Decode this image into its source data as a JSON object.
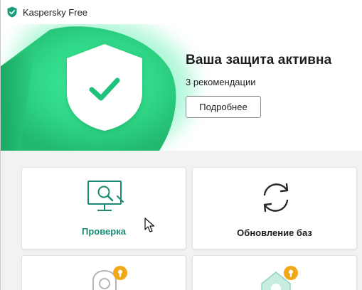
{
  "window": {
    "title": "Kaspersky Free"
  },
  "hero": {
    "status_title": "Ваша защита активна",
    "recommendations": "3 рекомендации",
    "details_button": "Подробнее",
    "shield_icon": "shield-check-icon"
  },
  "tiles": [
    {
      "label": "Проверка",
      "icon": "monitor-scan-icon",
      "state": "hovered"
    },
    {
      "label": "Обновление баз",
      "icon": "refresh-icon",
      "state": "normal"
    },
    {
      "label": "",
      "icon": "user-lock-icon",
      "state": "locked"
    },
    {
      "label": "",
      "icon": "home-lock-icon",
      "state": "locked"
    }
  ],
  "colors": {
    "accent_green": "#1a8a72",
    "hero_green": "#3ddc8f",
    "lock_badge": "#f0a818",
    "background": "#f2f2f2"
  }
}
